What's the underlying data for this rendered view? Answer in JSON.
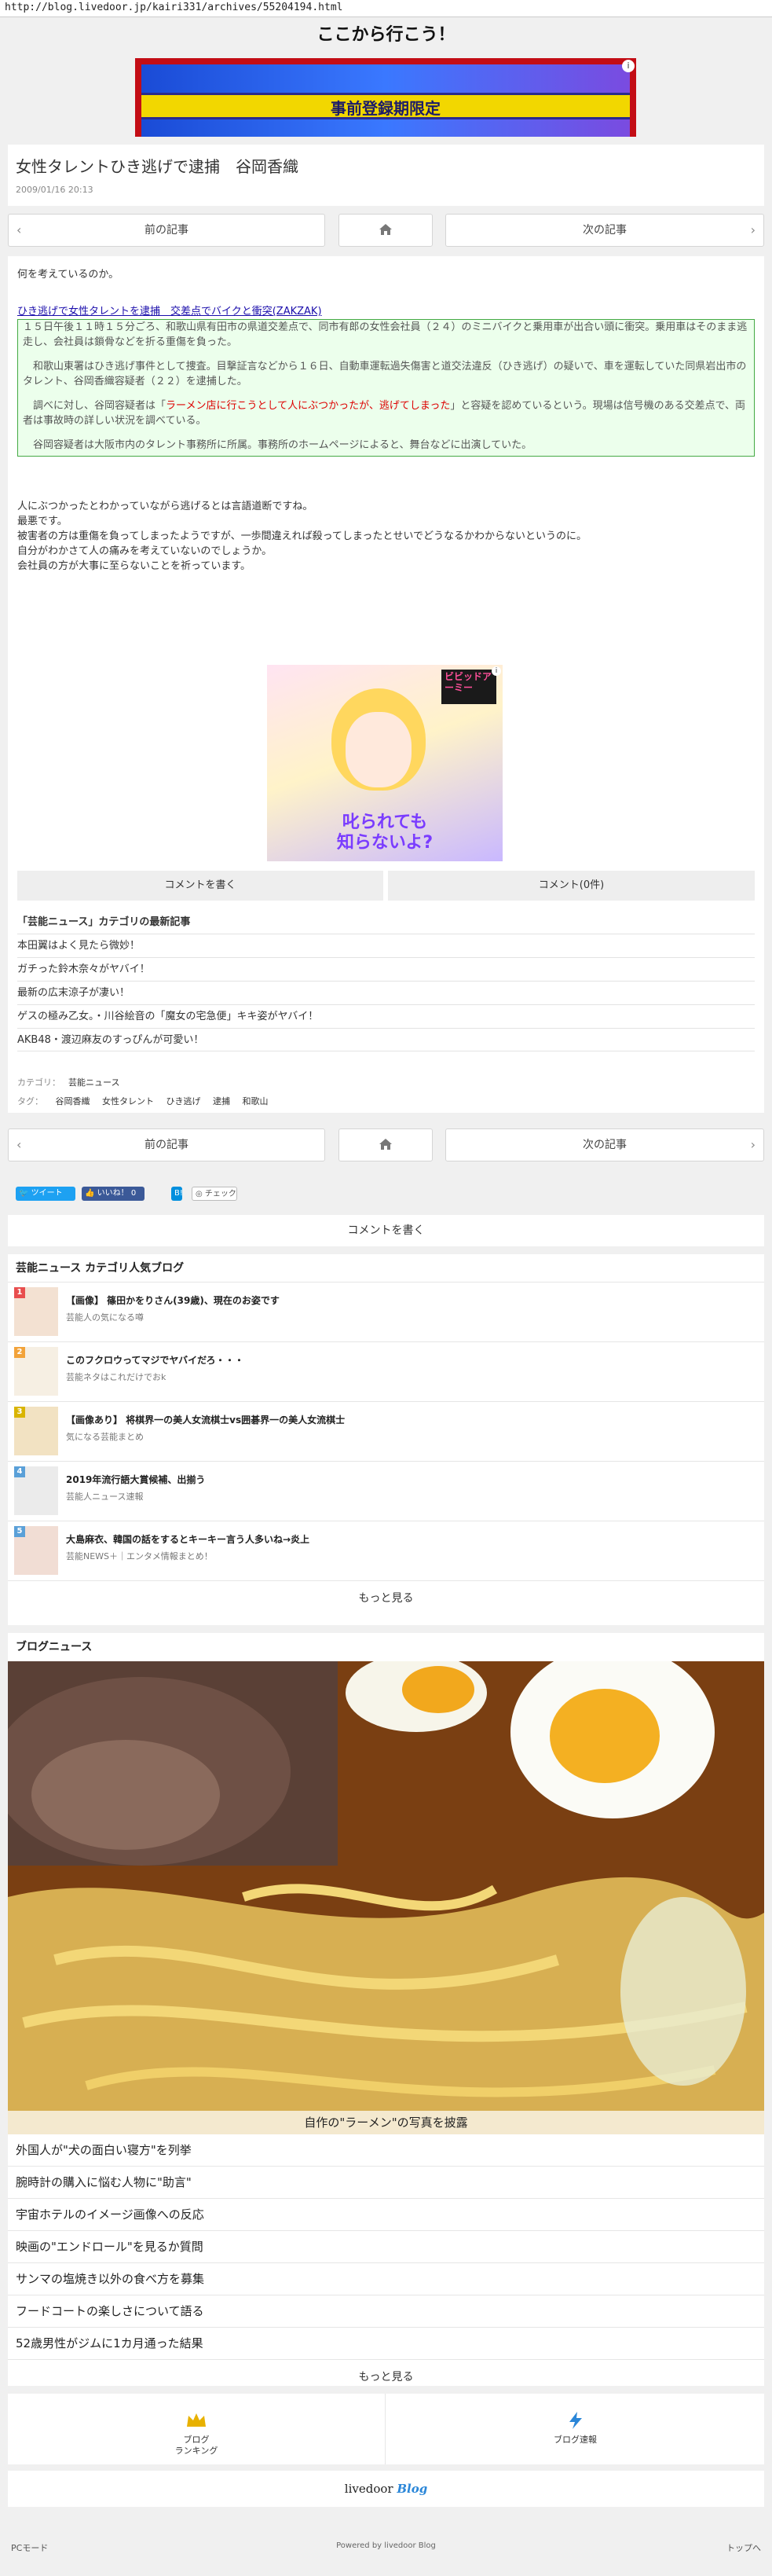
{
  "url": "http://blog.livedoor.jp/kairi331/archives/55204194.html",
  "blog_title": "ここから行こう！",
  "banner": {
    "text": "事前登録期限定"
  },
  "article": {
    "title": "女性タレントひき逃げで逮捕　谷岡香織",
    "date": "2009/01/16 20:13",
    "intro": "何を考えているのか。",
    "quote_link": "ひき逃げで女性タレントを逮捕　交差点でバイクと衝突(ZAKZAK)",
    "quote_p1": "１５日午後１１時１５分ごろ、和歌山県有田市の県道交差点で、同市有郎の女性会社員（２４）のミニバイクと乗用車が出合い頭に衝突。乗用車はそのまま逃走し、会社員は鎖骨などを折る重傷を負った。",
    "quote_p2": "和歌山東署はひき逃げ事件として捜査。目撃証言などから１６日、自動車運転過失傷害と道交法違反（ひき逃げ）の疑いで、車を運転していた同県岩出市のタレント、谷岡香織容疑者（２２）を逮捕した。",
    "quote_p3_a": "調べに対し、谷岡容疑者は「",
    "quote_p3_red": "ラーメン店に行こうとして人にぶつかったが、逃げてしまった",
    "quote_p3_b": "」と容疑を認めているという。現場は信号機のある交差点で、両者は事故時の詳しい状況を調べている。",
    "quote_p4": "谷岡容疑者は大阪市内のタレント事務所に所属。事務所のホームページによると、舞台などに出演していた。",
    "body_1": "人にぶつかったとわかっていながら逃げるとは言語道断ですね。",
    "body_2": "最悪です。",
    "body_3": "被害者の方は重傷を負ってしまったようですが、一歩間違えれば殺ってしまったとせいでどうなるかわからないというのに。",
    "body_4": "自分がわかさて人の痛みを考えていないのでしょうか。",
    "body_5": "会社員の方が大事に至らないことを祈っています。"
  },
  "ad": {
    "title": "ビビッドアーミー",
    "caption_1": "叱られても",
    "caption_2": "知らないよ?"
  },
  "pager": {
    "prev": "前の記事",
    "next": "次の記事"
  },
  "comments": {
    "write": "コメントを書く",
    "count": "コメント(0件)"
  },
  "recent": {
    "heading": "「芸能ニュース」カテゴリの最新記事",
    "items": [
      "本田翼はよく見たら微妙！",
      "ガチった鈴木奈々がヤバイ！",
      "最新の広末涼子が凄い！",
      "ゲスの極み乙女。・川谷絵音の「魔女の宅急便」キキ姿がヤバイ！",
      "AKB48・渡辺麻友のすっぴんが可愛い！"
    ]
  },
  "meta": {
    "category_label": "カテゴリ：",
    "category": "芸能ニュース",
    "tags_label": "タグ：",
    "tags": [
      "谷岡香織",
      "女性タレント",
      "ひき逃げ",
      "逮捕",
      "和歌山"
    ]
  },
  "social": {
    "tweet": "ツイート",
    "like": "いいね！ 0",
    "hatena": "B!",
    "check": "チェック"
  },
  "write_comment": "コメントを書く",
  "ranking": {
    "heading": "芸能ニュース カテゴリ人気ブログ",
    "items": [
      {
        "num": "1",
        "title": "【画像】 篠田かをりさん(39歳)、現在のお姿です",
        "blog": "芸能人の気になる噂",
        "color": "#e84e4e"
      },
      {
        "num": "2",
        "title": "このフクロウってマジでヤバイだろ・・・",
        "blog": "芸能ネタはこれだけでおk",
        "color": "#f2a33a"
      },
      {
        "num": "3",
        "title": "【画像あり】 将棋界一の美人女流棋士vs囲碁界一の美人女流棋士",
        "blog": "気になる芸能まとめ",
        "color": "#d9b400"
      },
      {
        "num": "4",
        "title": "2019年流行語大賞候補、出揃う",
        "blog": "芸能人ニュース速報",
        "color": "#5aa0d8"
      },
      {
        "num": "5",
        "title": "大島麻衣、韓国の話をするとキーキー言う人多いね→炎上",
        "blog": "芸能NEWS＋｜エンタメ情報まとめ！",
        "color": "#5aa0d8"
      }
    ],
    "more": "もっと見る"
  },
  "news": {
    "heading": "ブログニュース",
    "caption": "自作の\"ラーメン\"の写真を披露",
    "items": [
      "外国人が\"犬の面白い寝方\"を列挙",
      "腕時計の購入に悩む人物に\"助言\"",
      "宇宙ホテルのイメージ画像への反応",
      "映画の\"エンドロール\"を見るか質問",
      "サンマの塩焼き以外の食べ方を募集",
      "フードコートの楽しさについて語る",
      "52歳男性がジムに1カ月通った結果"
    ],
    "more": "もっと見る"
  },
  "bottom_nav": {
    "ranking_1": "ブログ",
    "ranking_2": "ランキング",
    "breaking": "ブログ速報"
  },
  "brand": {
    "livedoor": "livedoor",
    "blog": "Blog"
  },
  "footer": {
    "pc": "PCモード",
    "powered": "Powered by livedoor Blog",
    "top": "トップへ"
  }
}
